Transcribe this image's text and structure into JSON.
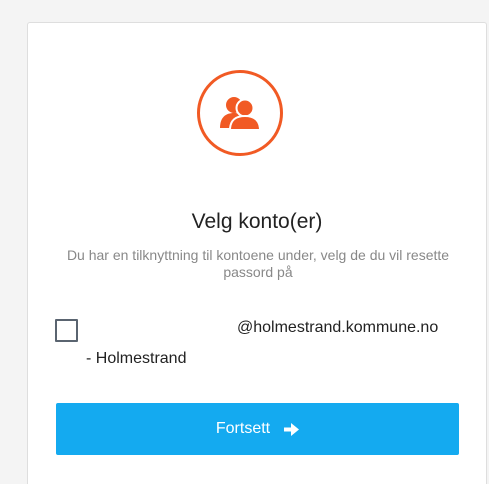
{
  "dialog": {
    "title": "Velg konto(er)",
    "subtitle": "Du har en tilknyttning til kontoene under, velg de du vil resette passord på",
    "icon": "users-icon",
    "accent_color": "#f15a24"
  },
  "accounts": [
    {
      "email": "@holmestrand.kommune.no",
      "organization": "- Holmestrand",
      "checked": false
    }
  ],
  "actions": {
    "continue_label": "Fortsett",
    "continue_icon": "arrow-right-icon",
    "button_color": "#14aaf0"
  }
}
